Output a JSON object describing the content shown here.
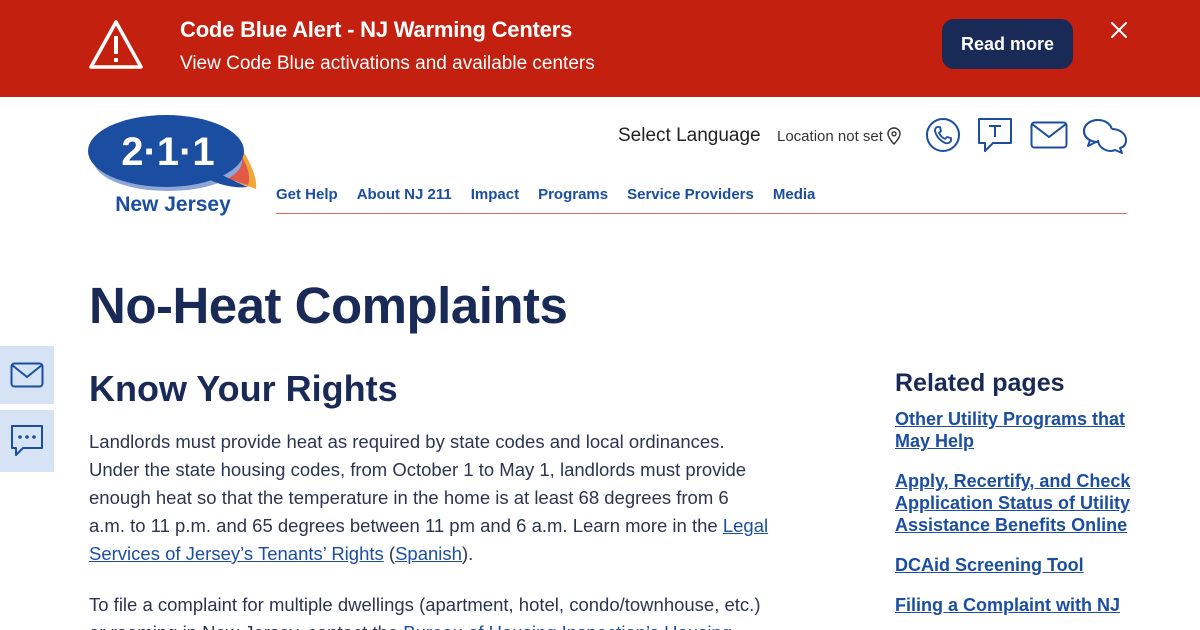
{
  "alert": {
    "title": "Code Blue Alert - NJ Warming Centers",
    "subtitle": "View Code Blue activations and available centers",
    "read_more": "Read more"
  },
  "logo": {
    "number": "2·1·1",
    "state": "New Jersey"
  },
  "header": {
    "select_language": "Select Language",
    "location": "Location not set"
  },
  "nav": {
    "items": [
      "Get Help",
      "About NJ 211",
      "Impact",
      "Programs",
      "Service Providers",
      "Media"
    ]
  },
  "main": {
    "title": "No-Heat Complaints",
    "section_title": "Know Your Rights",
    "p1_text": "Landlords must provide heat as required by state codes and local ordinances. Under the state housing codes, from October 1 to May 1, landlords must provide enough heat so that the temperature in the home is at least 68 degrees from 6 a.m. to 11 p.m. and 65 degrees between 11 pm and 6 a.m. Learn more in the ",
    "p1_link1": "Legal Services of Jersey’s Tenants’ Rights",
    "p1_mid": " (",
    "p1_link2": "Spanish",
    "p1_end": ").",
    "p2_text": "To file a complaint for multiple dwellings (apartment, hotel, condo/townhouse, etc.) or rooming in New Jersey, contact the ",
    "p2_link": "Bureau of Housing Inspection’s Housing"
  },
  "related": {
    "heading": "Related pages",
    "links": [
      "Other Utility Programs that May Help",
      "Apply, Recertify, and Check Application Status of Utility Assistance Benefits Online",
      "DCAid Screening Tool",
      "Filing a Complaint with NJ"
    ]
  },
  "colors": {
    "alert_bg": "#c4200f",
    "navy": "#1a2a57",
    "link_blue": "#1b4ea1",
    "side_bg": "#d6e3f5"
  },
  "icons": [
    "warning-icon",
    "close-icon",
    "location-pin-icon",
    "phone-icon",
    "text-icon",
    "email-icon",
    "chat-icon"
  ]
}
